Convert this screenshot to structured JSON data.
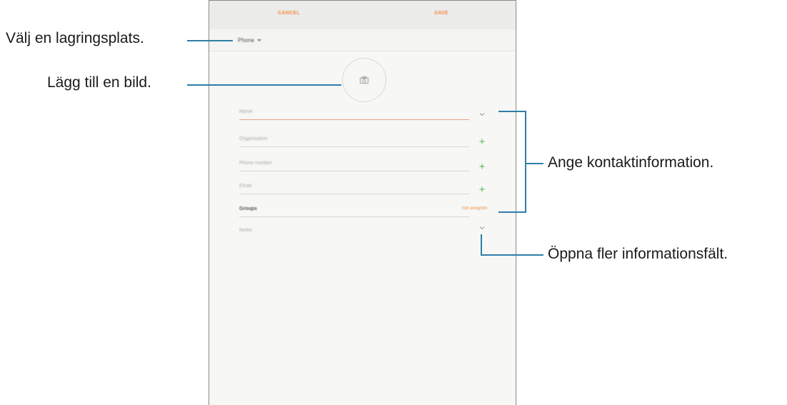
{
  "screen": {
    "action_bar": {
      "cancel_label": "CANCEL",
      "save_label": "SAVE"
    },
    "storage": {
      "selected": "Phone"
    },
    "photo": {
      "icon": "camera-icon"
    },
    "fields": [
      {
        "label": "Name",
        "action_icon": "chevron-down-icon"
      },
      {
        "label": "Organisation",
        "action_icon": "plus-icon"
      },
      {
        "label": "Phone number",
        "action_icon": "plus-icon"
      },
      {
        "label": "Email",
        "action_icon": "plus-icon"
      },
      {
        "label": "Notes",
        "action_icon": "chevron-down-icon"
      }
    ],
    "groups": {
      "label": "Groups",
      "value": "Not assigned"
    }
  },
  "callouts": {
    "storage": "Välj en lagringsplats.",
    "image": "Lägg till en bild.",
    "contact_info": "Ange kontaktinformation.",
    "more_fields": "Öppna fler informationsfält."
  },
  "colors": {
    "accent": "#f08a45",
    "leader_line": "#2f7fa8",
    "plus_icon": "#5bb85b"
  }
}
